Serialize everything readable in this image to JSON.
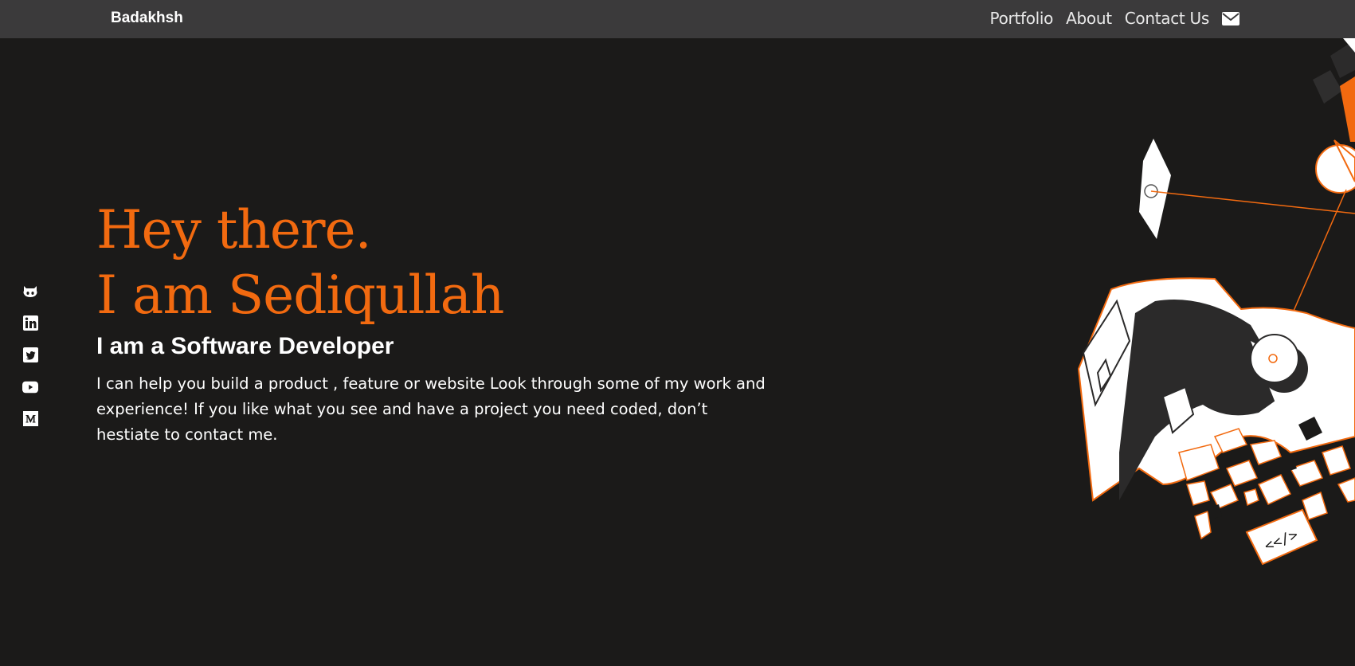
{
  "nav": {
    "brand": "Badakhsh",
    "links": [
      {
        "label": "Portfolio"
      },
      {
        "label": "About"
      },
      {
        "label": "Contact Us"
      }
    ],
    "mail_icon": "envelope-icon"
  },
  "social": [
    {
      "icon": "github-icon"
    },
    {
      "icon": "linkedin-icon"
    },
    {
      "icon": "twitter-icon"
    },
    {
      "icon": "youtube-icon"
    },
    {
      "icon": "medium-icon"
    }
  ],
  "hero": {
    "line1": "Hey there.",
    "line2": "I am Sediqullah",
    "subtitle": "I am a Software Developer",
    "description": "I can help you build a product , feature or website Look through some of my work and experience! If you like what you see and have a project you need coded, don’t hestiate to contact me.",
    "code_glyph": "<</>"
  },
  "colors": {
    "accent": "#f26a10",
    "background": "#1b1a19",
    "navbar": "#3b3a3b",
    "text": "#ffffff"
  }
}
